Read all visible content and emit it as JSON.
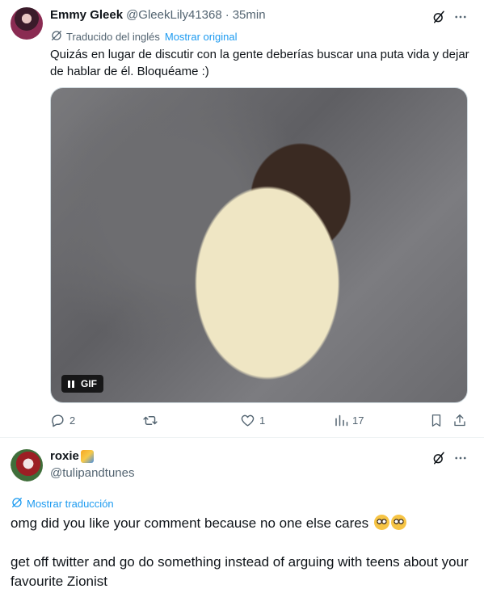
{
  "tweet1": {
    "display_name": "Emmy Gleek",
    "handle": "@GleekLily41368",
    "separator": "·",
    "time": "35min",
    "translated_label": "Traducido del inglés",
    "show_original": "Mostrar original",
    "text": "Quizás en lugar de discutir con la gente deberías buscar una puta vida y dejar de hablar de él. Bloquéame :)",
    "media": {
      "badge": "GIF"
    },
    "actions": {
      "replies": "2",
      "retweets": "",
      "likes": "1",
      "views": "17"
    }
  },
  "tweet2": {
    "display_name": "roxie",
    "handle": "@tulipandtunes",
    "show_translation": "Mostrar traducción",
    "line1": "omg did you like your comment because no one else cares",
    "line2": "get off twitter and go do something instead of arguing with teens about your favourite Zionist"
  },
  "icons": {
    "grok": "grok-icon",
    "more": "more-icon",
    "translate": "translate-icon",
    "reply": "reply-icon",
    "retweet": "retweet-icon",
    "like": "heart-icon",
    "views": "views-icon",
    "bookmark": "bookmark-icon",
    "share": "share-icon",
    "pause": "pause-icon"
  },
  "colors": {
    "text": "#0f1419",
    "secondary": "#536471",
    "link": "#1d9bf0",
    "divider": "#eff3f4"
  }
}
